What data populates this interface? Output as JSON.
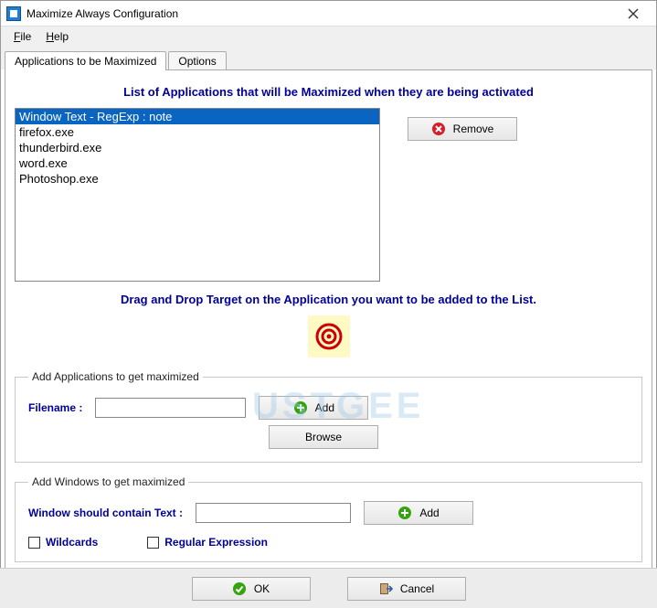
{
  "titlebar": {
    "title": "Maximize Always Configuration"
  },
  "menu": {
    "file": "File",
    "help": "Help"
  },
  "tabs": {
    "main": "Applications to be Maximized",
    "options": "Options"
  },
  "instr1": "List of Applications that will be Maximized when they are being activated",
  "list": {
    "items": [
      "Window Text - RegExp : note",
      "firefox.exe",
      "thunderbird.exe",
      "word.exe",
      "Photoshop.exe"
    ]
  },
  "remove_btn": "Remove",
  "instr2": "Drag and Drop Target on the Application you want to be added to the List.",
  "group_app": {
    "legend": "Add Applications to get maximized",
    "filename_label": "Filename :",
    "add_btn": "Add",
    "browse_btn": "Browse"
  },
  "group_win": {
    "legend": "Add Windows to get maximized",
    "text_label": "Window should contain Text :",
    "add_btn": "Add",
    "wildcards": "Wildcards",
    "regex": "Regular Expression"
  },
  "footer": {
    "ok": "OK",
    "cancel": "Cancel"
  },
  "watermark": "USTGEE"
}
